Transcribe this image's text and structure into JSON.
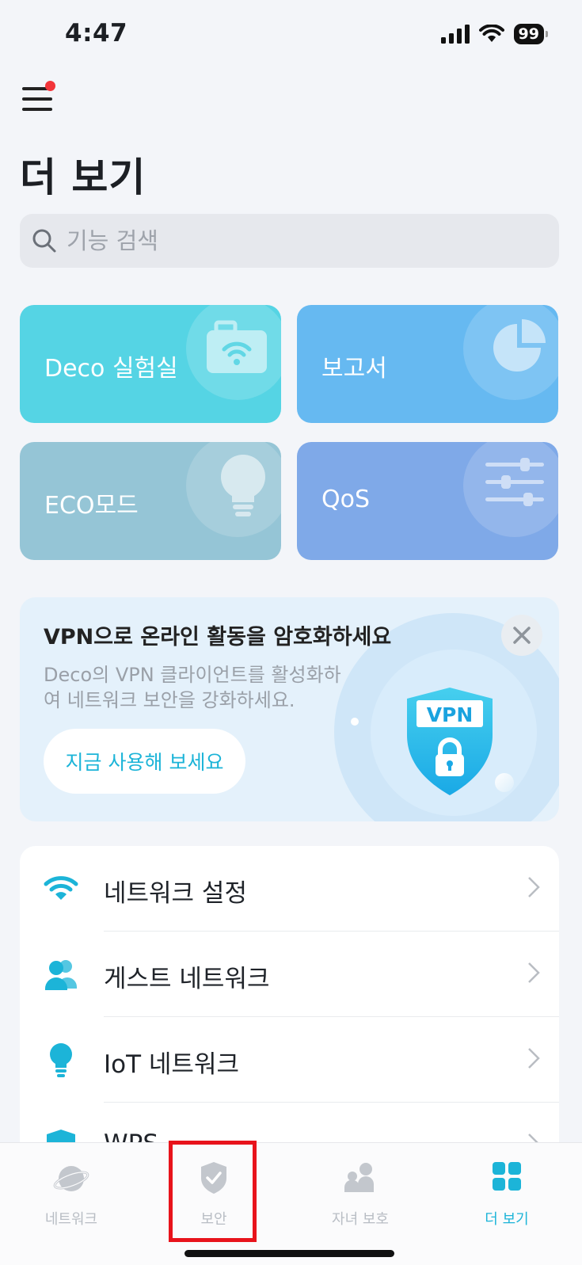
{
  "status": {
    "time": "4:47",
    "battery": "99"
  },
  "header": {
    "title": "더 보기"
  },
  "search": {
    "placeholder": "기능 검색"
  },
  "cards": [
    {
      "label": "Deco 실험실",
      "color": "#55d4e4",
      "icon": "toolbox-wifi-icon"
    },
    {
      "label": "보고서",
      "color": "#66b9f1",
      "icon": "pie-chart-icon"
    },
    {
      "label": "ECO모드",
      "color": "#95c5d6",
      "icon": "lightbulb-icon"
    },
    {
      "label": "QoS",
      "color": "#7fa9e8",
      "icon": "sliders-icon"
    }
  ],
  "vpn": {
    "title": "VPN으로 온라인 활동을 암호화하세요",
    "desc_line1": "Deco의 VPN 클라이언트를 활성화하",
    "desc_line2": "여 네트워크 보안을 강화하세요.",
    "cta": "지금 사용해 보세요",
    "badge": "VPN"
  },
  "list": [
    {
      "label": "네트워크 설정",
      "icon": "wifi-icon"
    },
    {
      "label": "게스트 네트워크",
      "icon": "guests-icon"
    },
    {
      "label": "IoT 네트워크",
      "icon": "lightbulb-icon"
    },
    {
      "label": "WPS",
      "icon": "shield-icon"
    }
  ],
  "tabs": [
    {
      "label": "네트워크",
      "active": false
    },
    {
      "label": "보안",
      "active": false
    },
    {
      "label": "자녀 보호",
      "active": false
    },
    {
      "label": "더 보기",
      "active": true
    }
  ],
  "accent": "#1cb4d8"
}
